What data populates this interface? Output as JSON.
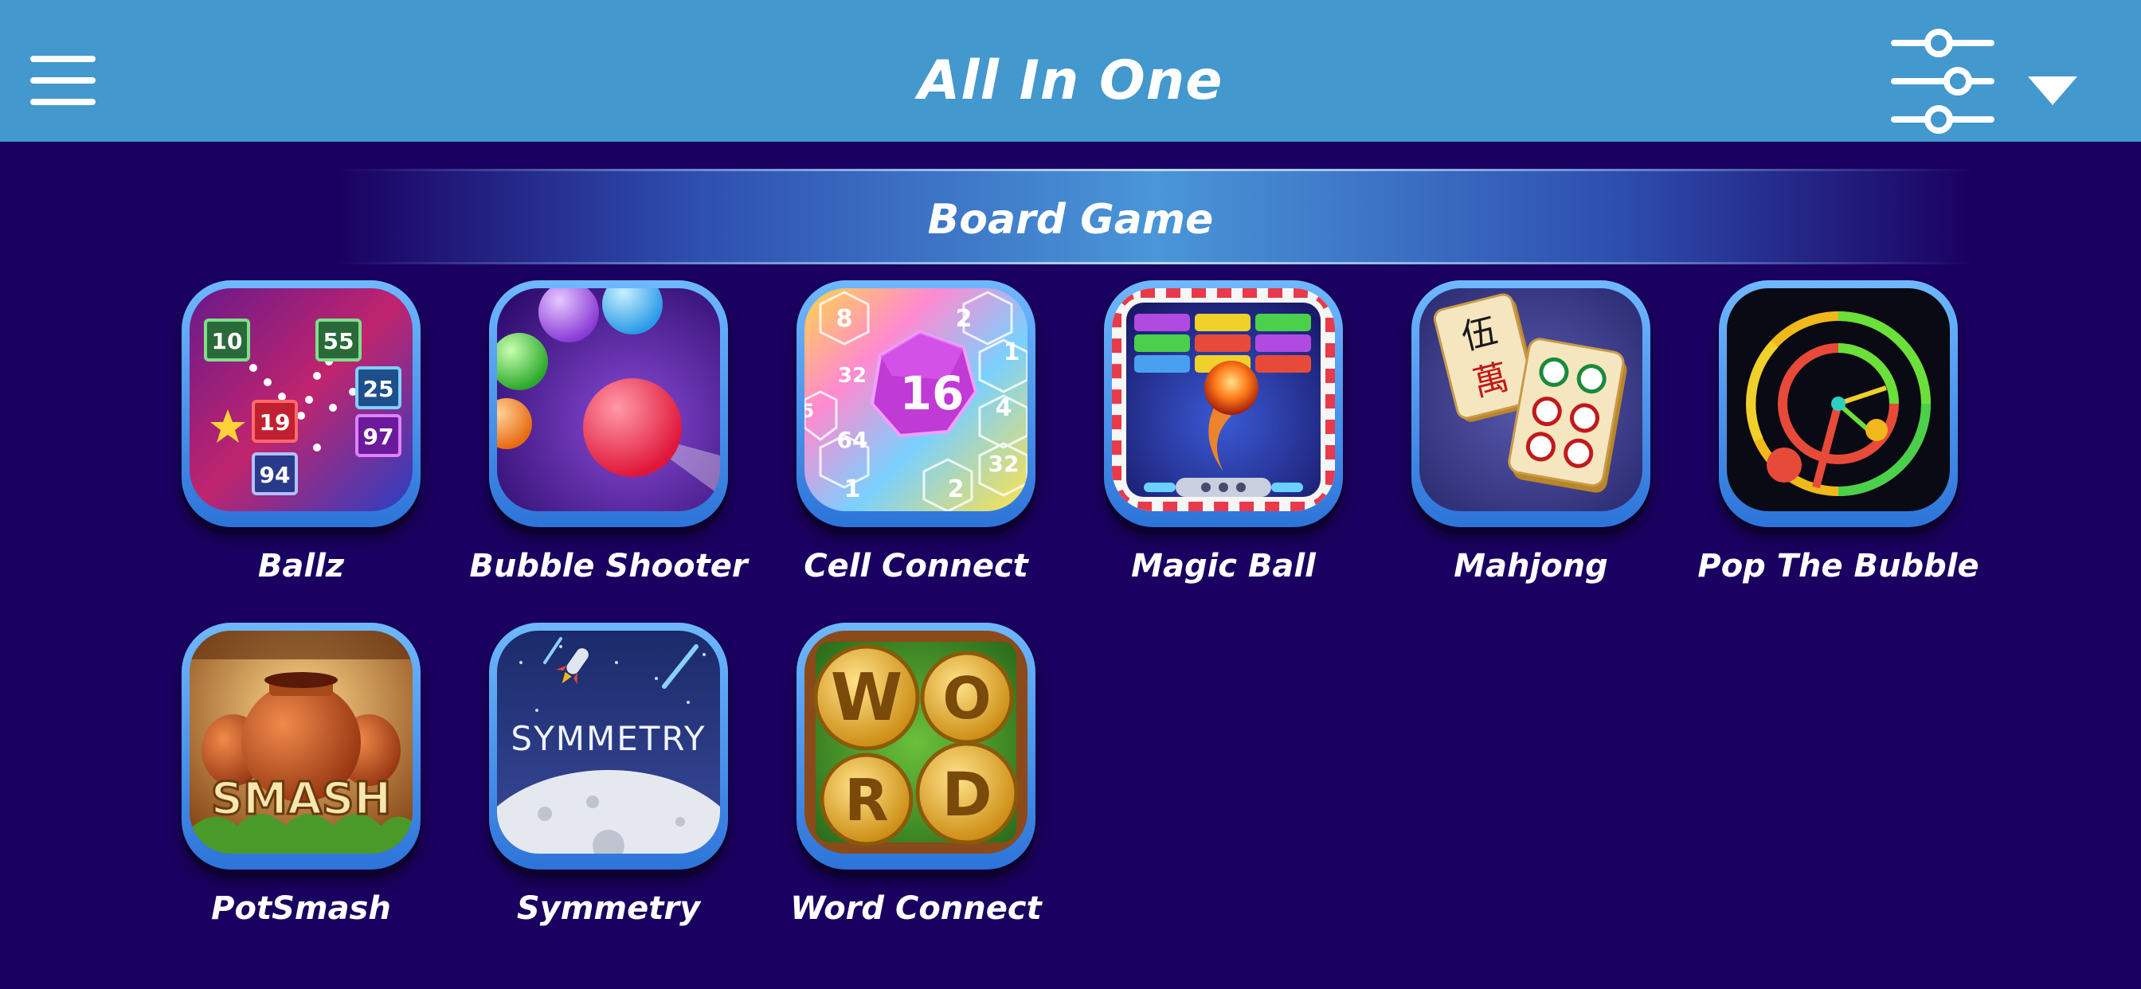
{
  "header": {
    "title": "All In One",
    "background": "#4398cd"
  },
  "section": {
    "title": "Board Game"
  },
  "colors": {
    "page_background": "#1a0060",
    "tile_frame": "#4a97ea"
  },
  "games": [
    {
      "label": "Ballz",
      "icon": "ballz-icon",
      "numbers": [
        "10",
        "55",
        "25",
        "19",
        "97",
        "94"
      ]
    },
    {
      "label": "Bubble Shooter",
      "icon": "bubble-shooter-icon"
    },
    {
      "label": "Cell Connect",
      "icon": "cell-connect-icon",
      "numbers": [
        "8",
        "2",
        "1",
        "32",
        "16",
        "4",
        "5",
        "64",
        "32",
        "1",
        "2"
      ]
    },
    {
      "label": "Magic Ball",
      "icon": "magic-ball-icon"
    },
    {
      "label": "Mahjong",
      "icon": "mahjong-icon"
    },
    {
      "label": "Pop The Bubble",
      "icon": "pop-the-bubble-icon"
    },
    {
      "label": "PotSmash",
      "icon": "potsmash-icon",
      "art_text": "SMASH"
    },
    {
      "label": "Symmetry",
      "icon": "symmetry-icon",
      "art_text": "SYMMETRY"
    },
    {
      "label": "Word Connect",
      "icon": "word-connect-icon",
      "letters": [
        "W",
        "O",
        "R",
        "D"
      ]
    }
  ]
}
